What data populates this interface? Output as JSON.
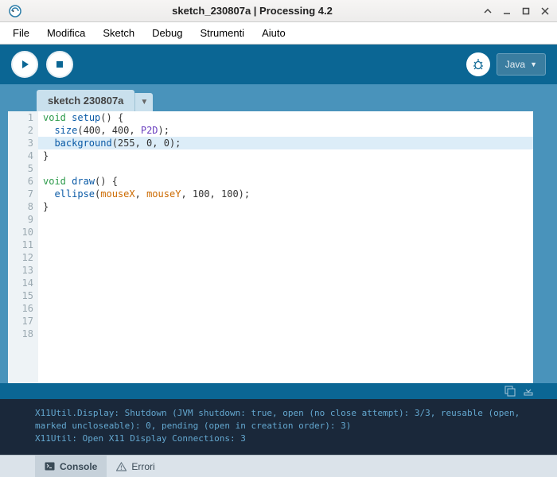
{
  "titlebar": {
    "title": "sketch_230807a | Processing 4.2"
  },
  "menubar": [
    "File",
    "Modifica",
    "Sketch",
    "Debug",
    "Strumenti",
    "Aiuto"
  ],
  "toolbar": {
    "mode": "Java",
    "mode_arrow": "▼"
  },
  "tabs": {
    "active": "sketch 230807a",
    "dropdown": "▼"
  },
  "code": {
    "lines": [
      {
        "n": 1,
        "hl": false,
        "tokens": [
          {
            "t": "void",
            "c": "kw"
          },
          {
            "t": " "
          },
          {
            "t": "setup",
            "c": "fn"
          },
          {
            "t": "() {"
          }
        ]
      },
      {
        "n": 2,
        "hl": false,
        "tokens": [
          {
            "t": "  "
          },
          {
            "t": "size",
            "c": "fn"
          },
          {
            "t": "(400, 400, "
          },
          {
            "t": "P2D",
            "c": "str"
          },
          {
            "t": ");"
          }
        ]
      },
      {
        "n": 3,
        "hl": true,
        "tokens": [
          {
            "t": "  "
          },
          {
            "t": "background",
            "c": "fn"
          },
          {
            "t": "(255, 0, 0);"
          }
        ]
      },
      {
        "n": 4,
        "hl": false,
        "tokens": [
          {
            "t": "}"
          }
        ]
      },
      {
        "n": 5,
        "hl": false,
        "tokens": [
          {
            "t": ""
          }
        ]
      },
      {
        "n": 6,
        "hl": false,
        "tokens": [
          {
            "t": "void",
            "c": "kw"
          },
          {
            "t": " "
          },
          {
            "t": "draw",
            "c": "fn"
          },
          {
            "t": "() {"
          }
        ]
      },
      {
        "n": 7,
        "hl": false,
        "tokens": [
          {
            "t": "  "
          },
          {
            "t": "ellipse",
            "c": "fn"
          },
          {
            "t": "("
          },
          {
            "t": "mouseX",
            "c": "type"
          },
          {
            "t": ", "
          },
          {
            "t": "mouseY",
            "c": "type"
          },
          {
            "t": ", 100, 100);"
          }
        ]
      },
      {
        "n": 8,
        "hl": false,
        "tokens": [
          {
            "t": "}"
          }
        ]
      }
    ],
    "total_lines": 18
  },
  "console": {
    "lines": [
      "X11Util.Display: Shutdown (JVM shutdown: true, open (no close attempt): 3/3, reusable (open, marked uncloseable): 0, pending (open in creation order): 3)",
      "X11Util: Open X11 Display Connections: 3"
    ]
  },
  "bottom_tabs": {
    "console": "Console",
    "errors": "Errori"
  }
}
